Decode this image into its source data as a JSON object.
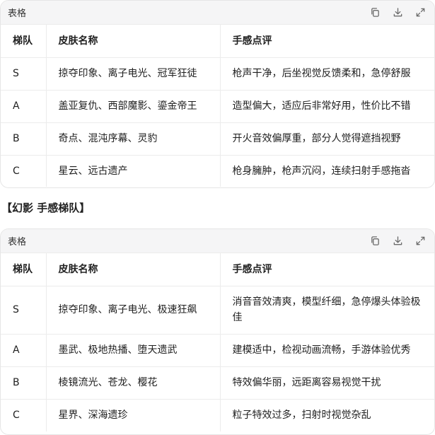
{
  "table1": {
    "header_title": "表格",
    "columns": [
      "梯队",
      "皮肤名称",
      "手感点评"
    ],
    "rows": [
      [
        "S",
        "掠夺印象、离子电光、冠军狂徒",
        "枪声干净，后坐视觉反馈柔和，急停舒服"
      ],
      [
        "A",
        "盖亚复仇、西部魔影、鎏金帝王",
        "造型偏大，适应后非常好用，性价比不错"
      ],
      [
        "B",
        "奇点、混沌序幕、灵豹",
        "开火音效偏厚重，部分人觉得遮挡视野"
      ],
      [
        "C",
        "星云、远古遗产",
        "枪身臃肿，枪声沉闷，连续扫射手感拖沓"
      ]
    ]
  },
  "section_title": "【幻影 手感梯队】",
  "table2": {
    "header_title": "表格",
    "columns": [
      "梯队",
      "皮肤名称",
      "手感点评"
    ],
    "rows": [
      [
        "S",
        "掠夺印象、离子电光、极速狂飙",
        "消音音效清爽，模型纤细，急停爆头体验极佳"
      ],
      [
        "A",
        "墨武、极地热播、堕天遗武",
        "建模适中，检视动画流畅，手游体验优秀"
      ],
      [
        "B",
        "棱镜流光、苍龙、樱花",
        "特效偏华丽，远距离容易视觉干扰"
      ],
      [
        "C",
        "星界、深海遗珍",
        "粒子特效过多，扫射时视觉杂乱"
      ]
    ]
  },
  "icons": [
    "copy-icon",
    "download-icon",
    "expand-icon"
  ]
}
